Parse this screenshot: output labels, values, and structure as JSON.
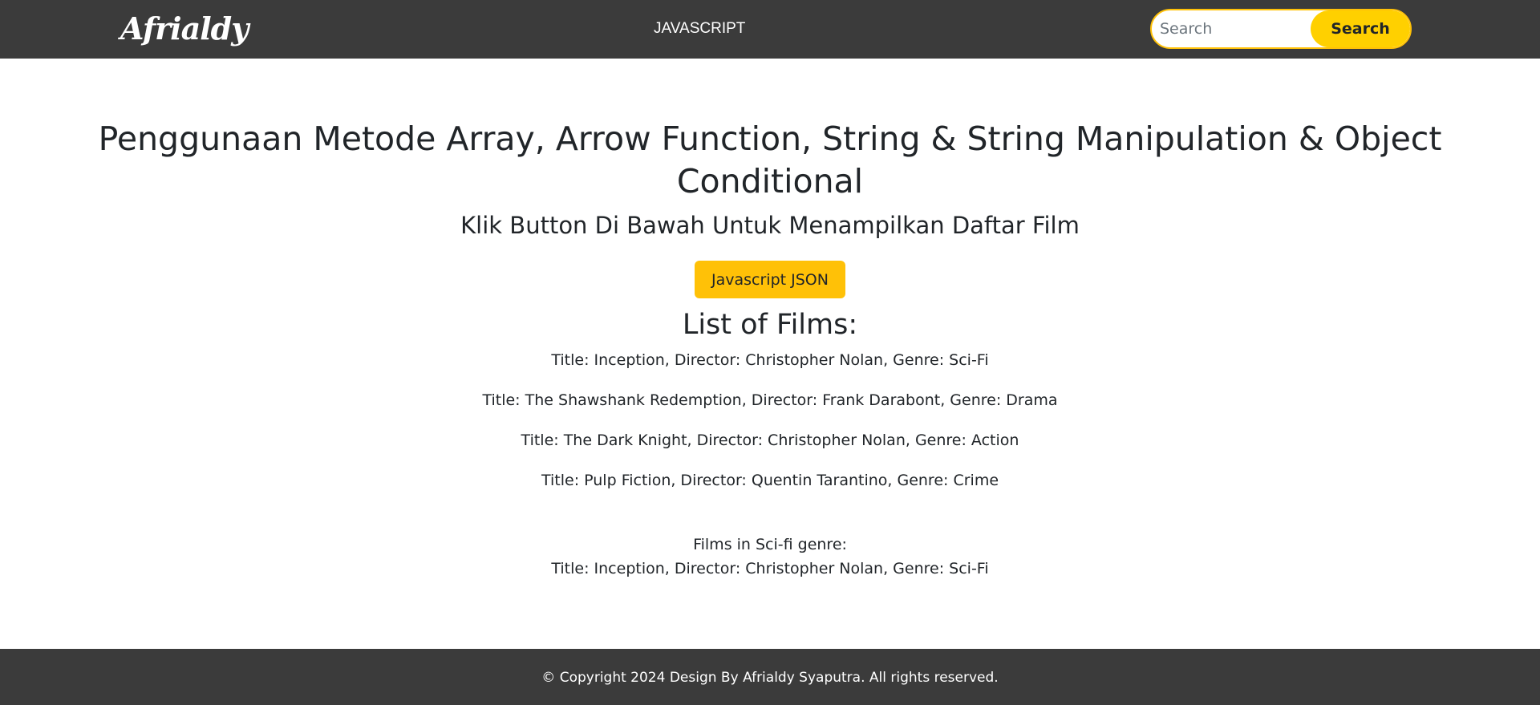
{
  "navbar": {
    "brand": "Afrialdy",
    "nav_link": "JAVASCRIPT",
    "search_placeholder": "Search",
    "search_button": "Search"
  },
  "main": {
    "title": "Penggunaan Metode Array, Arrow Function, String & String Manipulation & Object Conditional",
    "subtitle": "Klik Button Di Bawah Untuk Menampilkan Daftar Film",
    "button_label": "Javascript JSON",
    "list_heading": "List of Films:",
    "films": [
      "Title: Inception, Director: Christopher Nolan, Genre: Sci-Fi",
      "Title: The Shawshank Redemption, Director: Frank Darabont, Genre: Drama",
      "Title: The Dark Knight, Director: Christopher Nolan, Genre: Action",
      "Title: Pulp Fiction, Director: Quentin Tarantino, Genre: Crime"
    ],
    "scifi_label": "Films in Sci-fi genre:",
    "scifi_films": [
      "Title: Inception, Director: Christopher Nolan, Genre: Sci-Fi"
    ]
  },
  "footer": {
    "text": "© Copyright 2024 Design By Afrialdy Syaputra. All rights reserved."
  },
  "colors": {
    "navbar_bg": "#3b3b3b",
    "accent": "#ffc107",
    "search_button_bg": "#ffd000"
  }
}
